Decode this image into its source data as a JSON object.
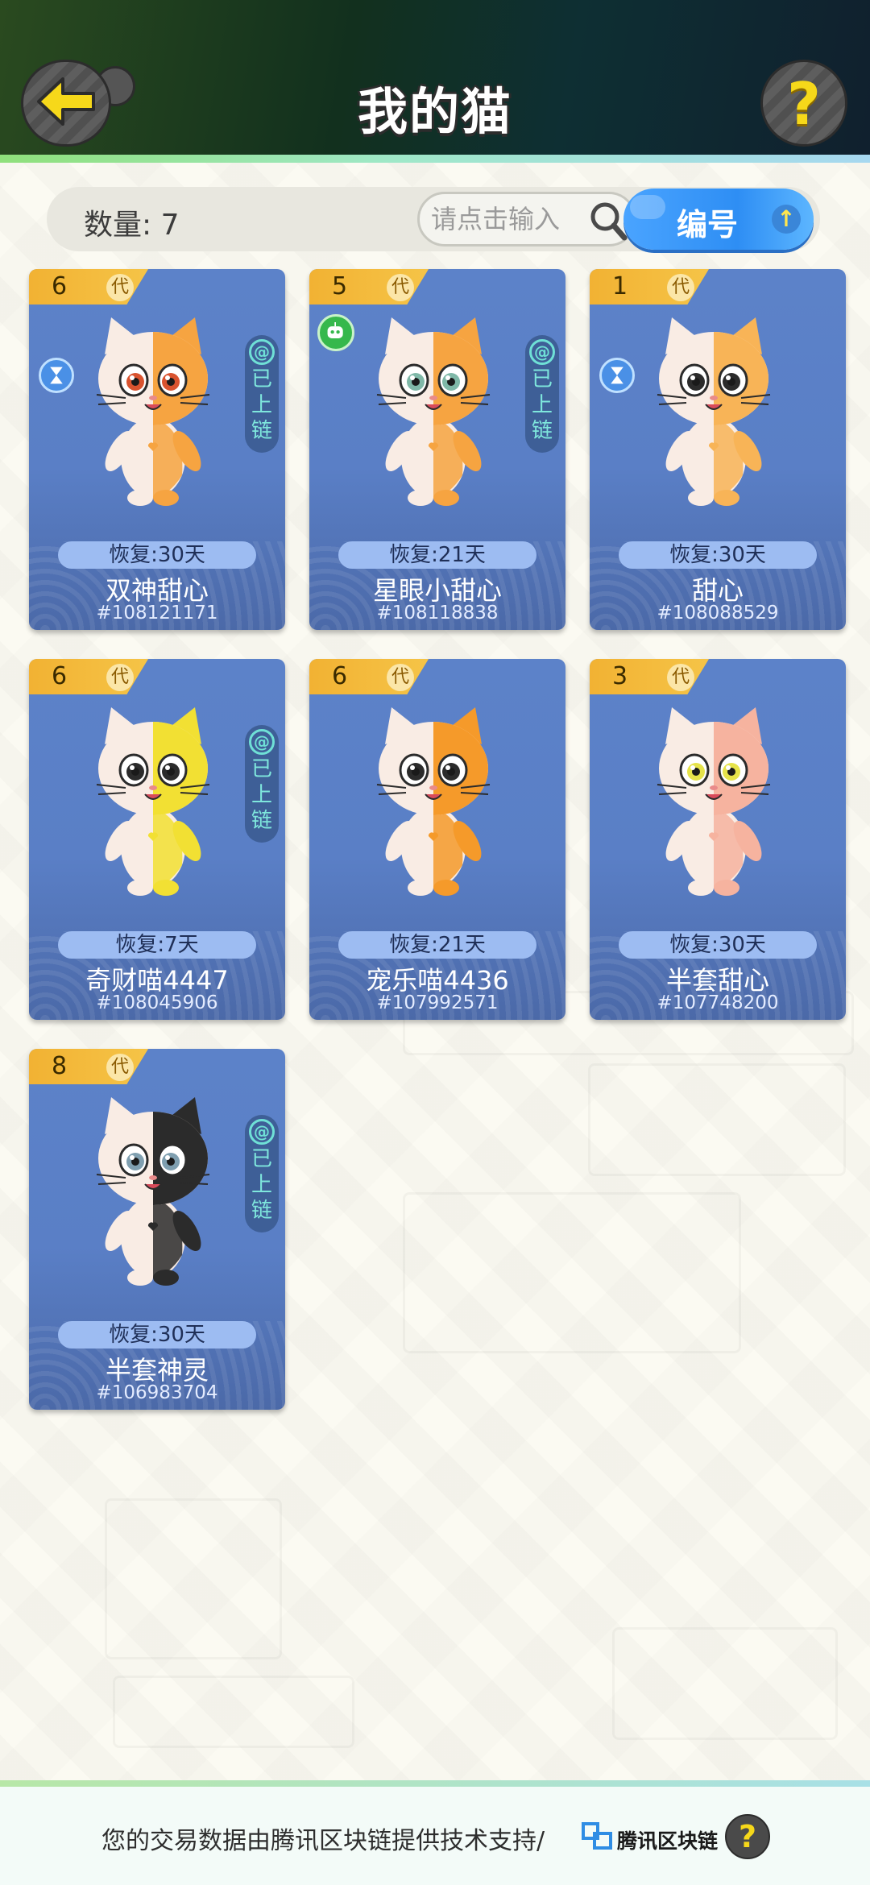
{
  "header": {
    "title": "我的猫",
    "back_icon": "back-arrow-icon",
    "help_icon": "question-icon",
    "help_symbol": "?"
  },
  "toolbar": {
    "count_label": "数量: 7",
    "search_placeholder": "请点击输入",
    "sort_label": "编号",
    "sort_direction_icon": "arrow-up-icon",
    "sort_arrow": "↑"
  },
  "cats": [
    {
      "generation": "6",
      "gen_suffix": "代",
      "status_icon": "hourglass-icon",
      "chain_label": "已上链",
      "chain_symbol": "@",
      "recover": "恢复:30天",
      "name": "双神甜心",
      "id": "#108121171",
      "body_color": "#f6a441",
      "eye_color": "#d9532f"
    },
    {
      "generation": "5",
      "gen_suffix": "代",
      "status_icon": "robot-icon",
      "chain_label": "已上链",
      "chain_symbol": "@",
      "recover": "恢复:21天",
      "name": "星眼小甜心",
      "id": "#108118838",
      "body_color": "#f6a441",
      "eye_color": "#7fb8a8"
    },
    {
      "generation": "1",
      "gen_suffix": "代",
      "status_icon": "hourglass-icon",
      "chain_label": "",
      "chain_symbol": "",
      "recover": "恢复:30天",
      "name": "甜心",
      "id": "#108088529",
      "body_color": "#f8b457",
      "eye_color": "#2b2b2b"
    },
    {
      "generation": "6",
      "gen_suffix": "代",
      "status_icon": "",
      "chain_label": "已上链",
      "chain_symbol": "@",
      "recover": "恢复:7天",
      "name": "奇财喵4447",
      "id": "#108045906",
      "body_color": "#f2e033",
      "eye_color": "#2b2b2b"
    },
    {
      "generation": "6",
      "gen_suffix": "代",
      "status_icon": "",
      "chain_label": "",
      "chain_symbol": "",
      "recover": "恢复:21天",
      "name": "宠乐喵4436",
      "id": "#107992571",
      "body_color": "#f59a2a",
      "eye_color": "#2b2b2b"
    },
    {
      "generation": "3",
      "gen_suffix": "代",
      "status_icon": "",
      "chain_label": "",
      "chain_symbol": "",
      "recover": "恢复:30天",
      "name": "半套甜心",
      "id": "#107748200",
      "body_color": "#f6b39f",
      "eye_color": "#e6e34a"
    },
    {
      "generation": "8",
      "gen_suffix": "代",
      "status_icon": "",
      "chain_label": "已上链",
      "chain_symbol": "@",
      "recover": "恢复:30天",
      "name": "半套神灵",
      "id": "#106983704",
      "body_color": "#2b2b2b",
      "eye_color": "#7f9fb0"
    }
  ],
  "footer": {
    "text": "您的交易数据由腾讯区块链提供技术支持/",
    "brand": "腾讯区块链",
    "help_symbol": "?"
  }
}
